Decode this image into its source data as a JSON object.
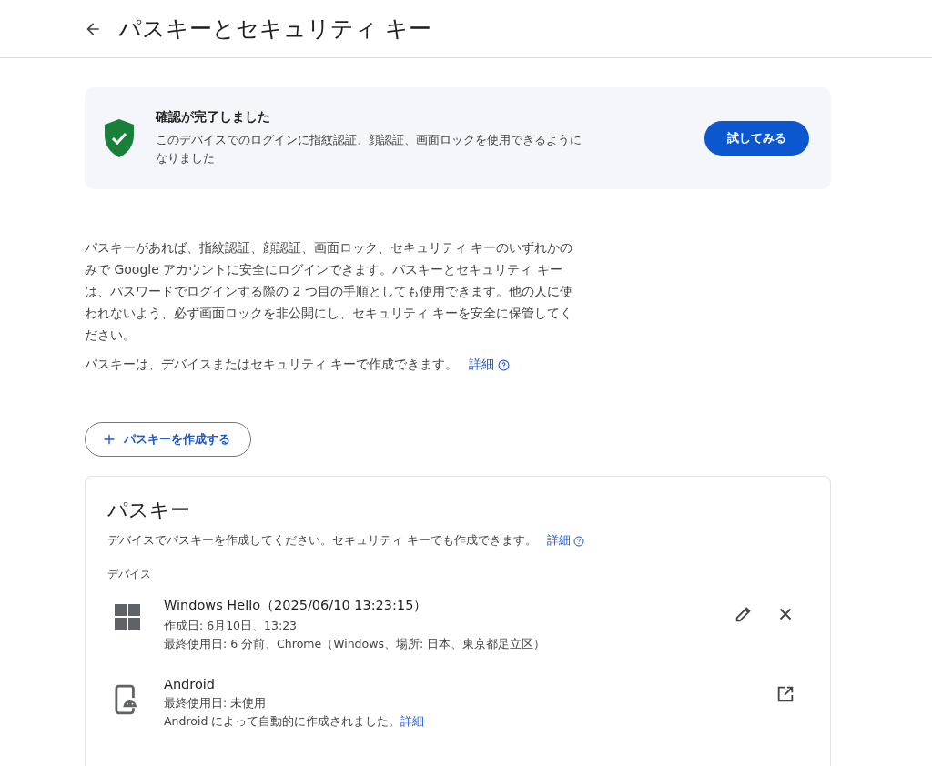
{
  "header": {
    "title": "パスキーとセキュリティ キー"
  },
  "banner": {
    "title": "確認が完了しました",
    "text": "このデバイスでのログインに指紋認証、顔認証、画面ロックを使用できるようになりました",
    "button": "試してみる"
  },
  "intro": {
    "paragraph": "パスキーがあれば、指紋認証、顔認証、画面ロック、セキュリティ キーのいずれかのみで Google アカウントに安全にログインできます。パスキーとセキュリティ キーは、パスワードでログインする際の 2 つ目の手順としても使用できます。他の人に使われないよう、必ず画面ロックを非公開にし、セキュリティ キーを安全に保管してください。",
    "note": "パスキーは、デバイスまたはセキュリティ キーで作成できます。",
    "link": "詳細"
  },
  "create_button": "パスキーを作成する",
  "passkeys": {
    "title": "パスキー",
    "description": "デバイスでパスキーを作成してください。セキュリティ キーでも作成できます。",
    "link": "詳細",
    "section_label": "デバイス",
    "devices": [
      {
        "kind": "windows",
        "name": "Windows Hello（2025/06/10 13:23:15）",
        "lines": [
          {
            "text": "作成日: 6月10日、13:23"
          },
          {
            "text": "最終使用日: 6 分前、Chrome（Windows、場所: 日本、東京都足立区）"
          }
        ],
        "actions": [
          {
            "kind": "edit"
          },
          {
            "kind": "remove"
          }
        ]
      },
      {
        "kind": "android",
        "name": "Android",
        "lines": [
          {
            "text": "最終使用日: 未使用"
          },
          {
            "text": "Android によって自動的に作成されました。",
            "link": "詳細"
          }
        ],
        "actions": [
          {
            "kind": "open"
          }
        ]
      }
    ]
  }
}
